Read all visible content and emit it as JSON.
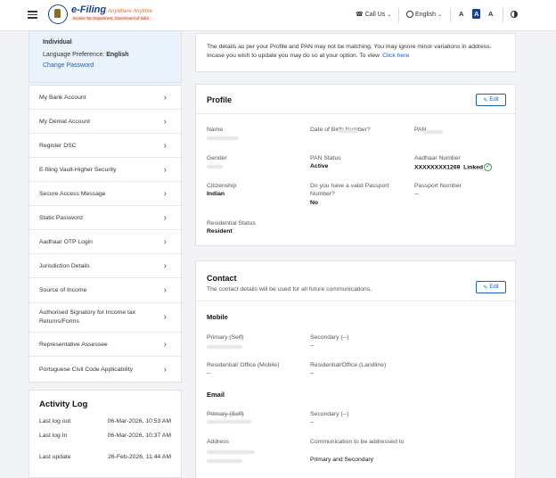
{
  "header": {
    "brand_title": "e-Filing",
    "brand_tagline": "Anywhere Anytime",
    "brand_subtitle": "Income Tax Department, Government of India",
    "call_us": "Call Us",
    "language": "English",
    "font_small": "A",
    "font_normal": "A",
    "font_large": "A",
    "icons": [
      "hamburger-icon",
      "phone-icon",
      "globe-icon",
      "chevron-down-icon",
      "contrast-icon"
    ]
  },
  "profile_summary": {
    "category": "Individual",
    "language_label": "Language Preference:",
    "language_value": "English",
    "change_password": "Change Password"
  },
  "menu": [
    "My Bank Account",
    "My Demat Account",
    "Register DSC",
    "E-filing Vault-Higher Security",
    "Secure Access Message",
    "Static Password",
    "Aadhaar OTP Login",
    "Jurisdiction Details",
    "Source of Income",
    "Authorised Signatory for Income tax Returns/Forms",
    "Representative Assessee",
    "Portuguese Civil Code Applicability"
  ],
  "activity_log": {
    "title": "Activity Log",
    "rows": [
      {
        "label": "Last log out",
        "value": "06-Mar-2026, 10:53 AM"
      },
      {
        "label": "Last log In",
        "value": "06-Mar-2026, 10:37 AM"
      },
      {
        "label": "Last update",
        "value": "26-Feb-2026, 11:44 AM"
      }
    ]
  },
  "notice": {
    "text": "The details as per your Profile and PAN may not be matching. You may ignore minor variations in address. Incase you wish to update you may do so at your option. To view",
    "link": "Click here"
  },
  "profile": {
    "title": "Profile",
    "edit": "Edit",
    "name_label": "Name",
    "dob_label": "Date of Birth Number?",
    "pan_label": "PAN",
    "gender_label": "Gender",
    "pan_status_label": "PAN Status",
    "pan_status": "Active",
    "aadhaar_label": "Aadhaar Number",
    "aadhaar_value": "XXXXXXXX1269",
    "aadhaar_status": "Linked",
    "citizenship_label": "Citizenship",
    "citizenship": "Indian",
    "passport_q_label": "Do you have a valid Passport Number?",
    "passport_q": "No",
    "passport_label": "Passport Number",
    "passport": "--",
    "residential_label": "Residential Status",
    "residential": "Resident"
  },
  "contact": {
    "title": "Contact",
    "subtitle": "The contact details will be used for all future communications.",
    "edit": "Edit",
    "mobile_heading": "Mobile",
    "primary_self": "Primary (Self)",
    "secondary_mobile": "Secondary (--)",
    "secondary_mobile_value": "--",
    "res_mobile_label": "Residential/ Office (Mobile)",
    "res_mobile_value": "--",
    "res_landline_label": "Residential/Office (Landline)",
    "res_landline_value": "--",
    "email_heading": "Email",
    "email_primary": "Primary (Self)",
    "email_secondary": "Secondary (--)",
    "email_secondary_value": "--",
    "address_label": "Address",
    "comm_label": "Communication to be addressed to",
    "comm_value": "Primary and Secondary"
  }
}
